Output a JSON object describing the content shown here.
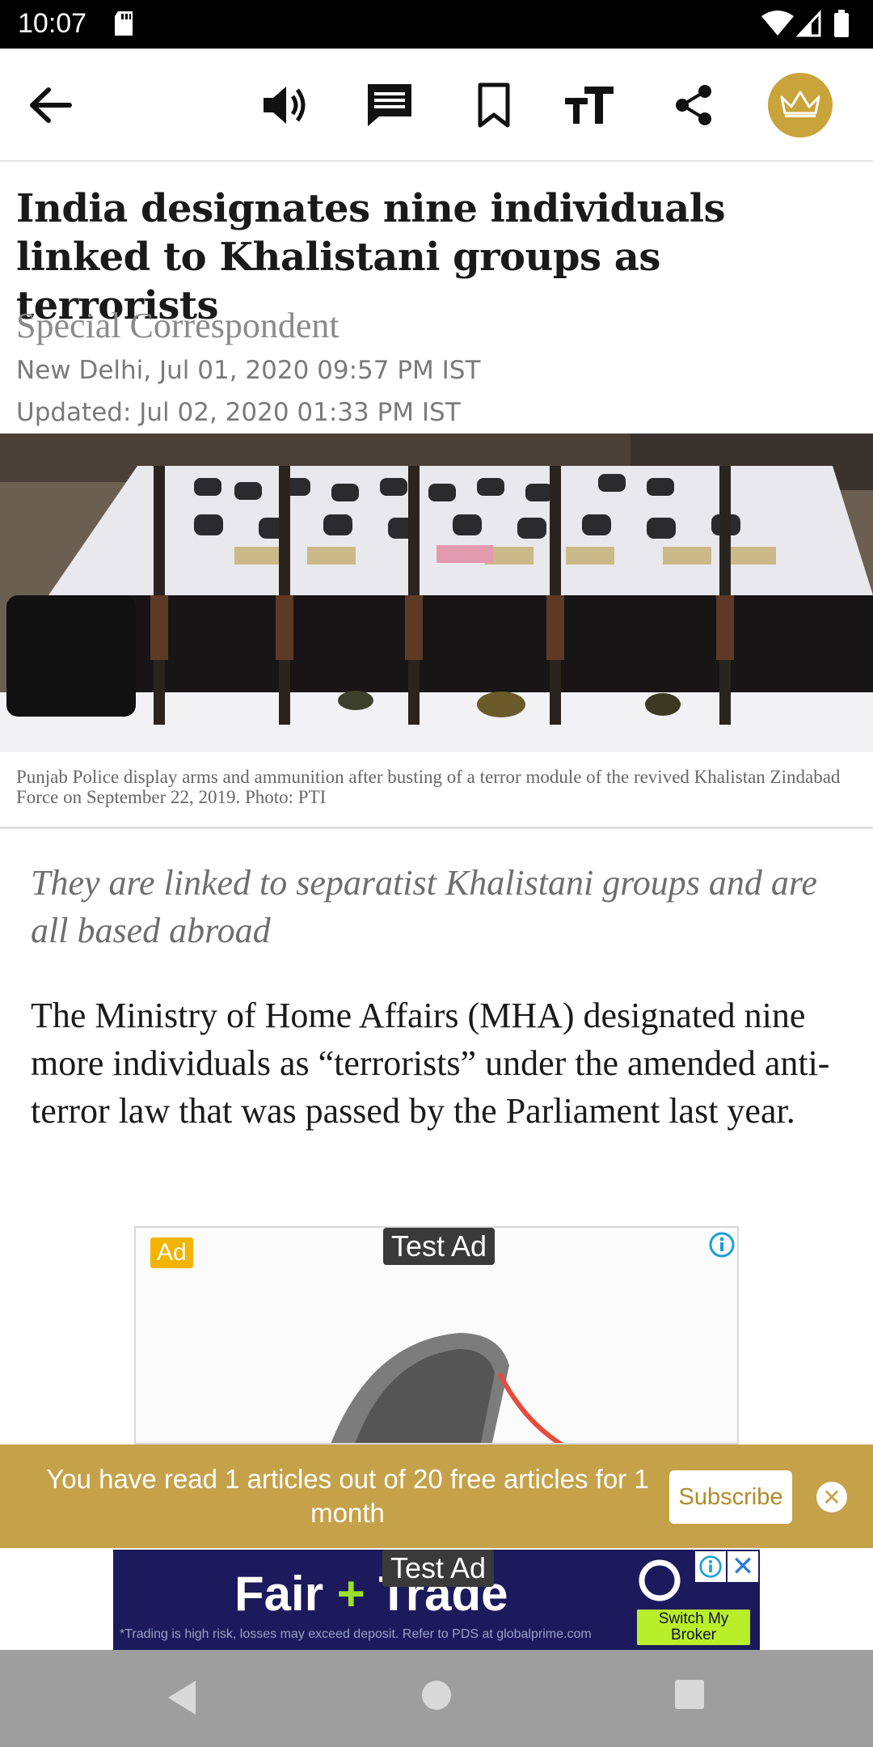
{
  "status_bar": {
    "time": "10:07"
  },
  "toolbar": {
    "icons": [
      "back-arrow-icon",
      "speaker-icon",
      "comment-icon",
      "bookmark-icon",
      "text-size-icon",
      "share-icon",
      "crown-icon"
    ],
    "accent": "#c9a43a"
  },
  "article": {
    "headline": "India designates nine individuals linked to Khalistani groups as terrorists",
    "byline": "Special Correspondent",
    "location": "New Delhi,",
    "published": "Jul 01, 2020 09:57 PM IST",
    "updated": "Updated: Jul 02, 2020 01:33 PM IST",
    "photo_caption": "Punjab Police display arms and ammunition after busting of a terror module of the revived Khalistan Zindabad Force on September 22, 2019. Photo: PTI",
    "standfirst": "They are linked to separatist Khalistani groups and are all based abroad",
    "body": "The Ministry of Home Affairs (MHA) designated nine more individuals as “terrorists” under the amended anti-terror law that was passed by the Parliament last year."
  },
  "ad_box": {
    "badge": "Ad",
    "test_label": "Test Ad"
  },
  "subscribe_banner": {
    "message": "You have read 1 articles out of 20 free articles for 1 month",
    "button": "Subscribe",
    "color": "#c5a24a"
  },
  "bottom_ad": {
    "test_label": "Test Ad",
    "headline_left": "Fair",
    "headline_plus": "+",
    "headline_right": "Trade",
    "disclaimer": "*Trading is high risk, losses may exceed deposit. Refer to PDS at globalprime.com",
    "cta": "Switch My Broker",
    "background": "#1c1a5c"
  },
  "nav_bar": {
    "icons": [
      "nav-back-icon",
      "nav-home-icon",
      "nav-recents-icon"
    ]
  }
}
